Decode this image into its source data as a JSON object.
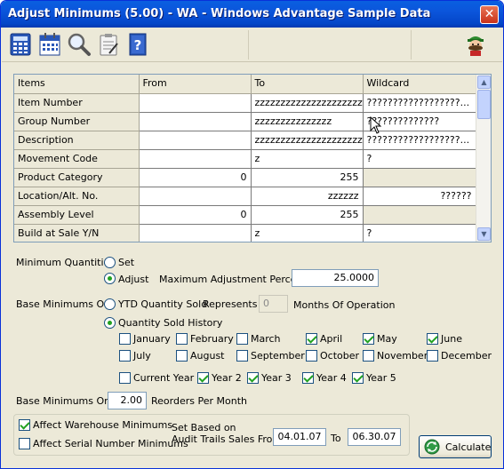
{
  "window": {
    "title": "Adjust Minimums (5.00) - WA - Windows Advantage Sample Data",
    "close_glyph": "✕"
  },
  "toolbar": {
    "buttons": [
      "calculator-icon",
      "calendar-icon",
      "magnifier-icon",
      "clipboard-icon",
      "help-book-icon"
    ],
    "mascot": "mascot-icon"
  },
  "grid": {
    "columns": [
      "Items",
      "From",
      "To",
      "Wildcard"
    ],
    "rows": [
      {
        "item": "Item Number",
        "from": "",
        "to": "zzzzzzzzzzzzzzzzzzzzz",
        "wildcard": "??????????????????..."
      },
      {
        "item": "Group Number",
        "from": "",
        "to": "zzzzzzzzzzzzzzz",
        "wildcard": "??????????????"
      },
      {
        "item": "Description",
        "from": "",
        "to": "zzzzzzzzzzzzzzzzzzzzz",
        "wildcard": "??????????????????..."
      },
      {
        "item": "Movement Code",
        "from": "",
        "to": "z",
        "wildcard": "?"
      },
      {
        "item": "Product Category",
        "from": "0",
        "to": "255",
        "wildcard": ""
      },
      {
        "item": "Location/Alt. No.",
        "from": "",
        "to": "zzzzzz",
        "wildcard": "??????"
      },
      {
        "item": "Assembly Level",
        "from": "0",
        "to": "255",
        "wildcard": ""
      },
      {
        "item": "Build at Sale Y/N",
        "from": "",
        "to": "z",
        "wildcard": "?"
      }
    ],
    "scroll_up": "▲",
    "scroll_down": "▼"
  },
  "minimum_quantities": {
    "label": "Minimum Quantities",
    "set_label": "Set",
    "adjust_label": "Adjust",
    "selected": "Adjust",
    "max_adjust_label": "Maximum Adjustment Percent",
    "max_adjust_value": "25.0000"
  },
  "base_minimums": {
    "label": "Base Minimums On",
    "ytd_label": "YTD Quantity Sold",
    "represents_label": "Represents",
    "months_value": "0",
    "months_label": "Months Of Operation",
    "history_label": "Quantity Sold History",
    "selected": "Quantity Sold History"
  },
  "months": [
    {
      "label": "January",
      "checked": false
    },
    {
      "label": "February",
      "checked": false
    },
    {
      "label": "March",
      "checked": false
    },
    {
      "label": "April",
      "checked": true
    },
    {
      "label": "May",
      "checked": true
    },
    {
      "label": "June",
      "checked": true
    },
    {
      "label": "July",
      "checked": false
    },
    {
      "label": "August",
      "checked": false
    },
    {
      "label": "September",
      "checked": false
    },
    {
      "label": "October",
      "checked": false
    },
    {
      "label": "November",
      "checked": false
    },
    {
      "label": "December",
      "checked": false
    }
  ],
  "years": [
    {
      "label": "Current Year",
      "checked": false
    },
    {
      "label": "Year 2",
      "checked": true
    },
    {
      "label": "Year 3",
      "checked": true
    },
    {
      "label": "Year 4",
      "checked": true
    },
    {
      "label": "Year 5",
      "checked": true
    }
  ],
  "reorders": {
    "label": "Base Minimums On",
    "value": "2.00",
    "suffix": "Reorders Per Month"
  },
  "affect": {
    "warehouse_label": "Affect Warehouse Minimums",
    "warehouse_checked": true,
    "serial_label": "Affect Serial Number Minimums",
    "serial_checked": false,
    "set_based_line1": "Set Based on",
    "set_based_line2": "Audit Trails Sales From",
    "from_date": "04.01.07",
    "to_label": "To",
    "to_date": "06.30.07"
  },
  "calculate": {
    "label": "Calculate"
  },
  "colors": {
    "titlebar": "#0a5fe0",
    "check_green": "#21a121",
    "dialog_bg": "#ece9d8"
  }
}
